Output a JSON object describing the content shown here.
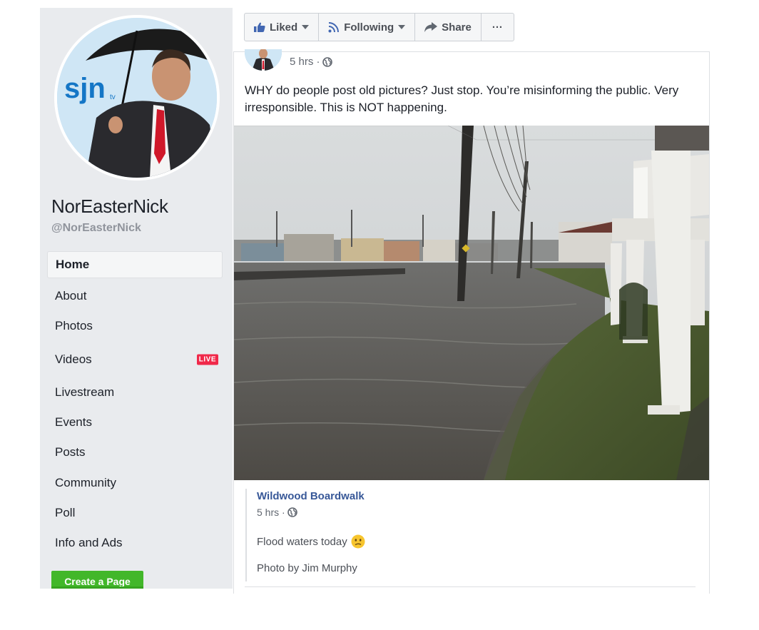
{
  "page": {
    "name": "NorEasterNick",
    "handle": "@NorEasterNick",
    "logo_text": "sjn",
    "logo_sub": "tv"
  },
  "nav": {
    "items": [
      {
        "label": "Home",
        "active": true
      },
      {
        "label": "About"
      },
      {
        "label": "Photos"
      },
      {
        "label": "Videos",
        "badge": "LIVE"
      },
      {
        "label": "Livestream"
      },
      {
        "label": "Events"
      },
      {
        "label": "Posts"
      },
      {
        "label": "Community"
      },
      {
        "label": "Poll"
      },
      {
        "label": "Info and Ads"
      }
    ],
    "create_page": "Create a Page"
  },
  "toolbar": {
    "liked": "Liked",
    "following": "Following",
    "share": "Share",
    "more": "···"
  },
  "post": {
    "time": "5 hrs ·",
    "text": "WHY do people post old pictures? Just stop. You’re misinforming the public. Very irresponsible. This is NOT happening.",
    "shared": {
      "name": "Wildwood Boardwalk",
      "time": "5 hrs ·",
      "text": "Flood waters today",
      "credit": "Photo by Jim Murphy"
    }
  },
  "colors": {
    "sidebar_bg": "#e9ebee",
    "link_blue": "#385898",
    "live_red": "#f02849",
    "create_green": "#42b72a"
  }
}
